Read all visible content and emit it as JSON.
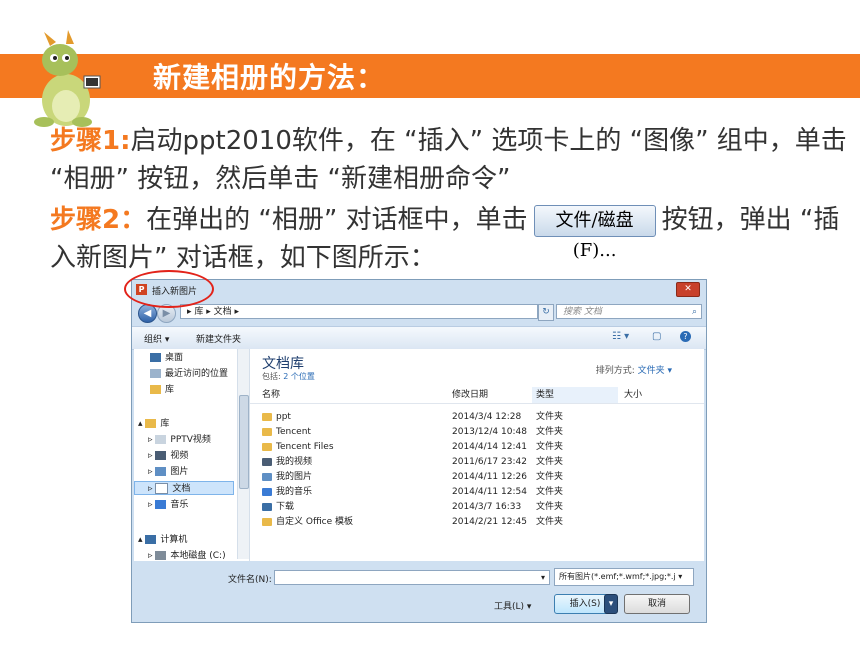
{
  "slide": {
    "heading": "新建相册的方法：",
    "step1": {
      "label": "步骤1:",
      "text": "启动ppt2010软件，在 “插入” 选项卡上的 “图像” 组中，单击 “相册” 按钮，然后单击 “新建相册命令”"
    },
    "step2": {
      "label": "步骤2：",
      "text_before": "在弹出的 “相册” 对话框中，单击",
      "button_label": "文件/磁盘(F)...",
      "text_after": "按钮，弹出 “插入新图片” 对话框，如下图所示："
    }
  },
  "dialog": {
    "title": "插入新图片",
    "app_icon": "P",
    "close_label": "✕",
    "address": "▸ 库 ▸ 文档 ▸",
    "search_placeholder": "搜索 文档",
    "toolbar": {
      "organize": "组织 ▾",
      "new_folder": "新建文件夹"
    },
    "nav": [
      {
        "label": "桌面",
        "icon": "desktop-icon"
      },
      {
        "label": "最近访问的位置",
        "icon": "recent-places-icon"
      },
      {
        "label": "库",
        "icon": "library-icon"
      },
      {
        "label": "库",
        "icon": "library-icon"
      },
      {
        "label": "PPTV视频",
        "icon": "library-icon"
      },
      {
        "label": "视频",
        "icon": "video-icon"
      },
      {
        "label": "图片",
        "icon": "picture-icon"
      },
      {
        "label": "文档",
        "icon": "document-icon"
      },
      {
        "label": "音乐",
        "icon": "music-icon"
      },
      {
        "label": "计算机",
        "icon": "computer-icon"
      },
      {
        "label": "本地磁盘 (C:)",
        "icon": "drive-icon"
      }
    ],
    "library": {
      "title": "文档库",
      "includes_prefix": "包括:",
      "includes_link": "2 个位置",
      "arrange_label": "排列方式:",
      "arrange_value": "文件夹 ▾"
    },
    "columns": {
      "name": "名称",
      "date": "修改日期",
      "type": "类型",
      "size": "大小"
    },
    "files": [
      {
        "name": "ppt",
        "date": "2014/3/4 12:28",
        "type": "文件夹"
      },
      {
        "name": "Tencent",
        "date": "2013/12/4 10:48",
        "type": "文件夹"
      },
      {
        "name": "Tencent Files",
        "date": "2014/4/14 12:41",
        "type": "文件夹"
      },
      {
        "name": "我的视频",
        "date": "2011/6/17 23:42",
        "type": "文件夹"
      },
      {
        "name": "我的图片",
        "date": "2014/4/11 12:26",
        "type": "文件夹"
      },
      {
        "name": "我的音乐",
        "date": "2014/4/11 12:54",
        "type": "文件夹"
      },
      {
        "name": "下载",
        "date": "2014/3/7 16:33",
        "type": "文件夹"
      },
      {
        "name": "自定义 Office 模板",
        "date": "2014/2/21 12:45",
        "type": "文件夹"
      }
    ],
    "filename_label": "文件名(N):",
    "filename_value": "",
    "filetype_value": "所有图片(*.emf;*.wmf;*.jpg;*.j ▾",
    "tools_label": "工具(L)  ▾",
    "insert_label": "插入(S)",
    "cancel_label": "取消"
  },
  "colors": {
    "accent": "#f47920",
    "annotation": "#e2231a"
  }
}
